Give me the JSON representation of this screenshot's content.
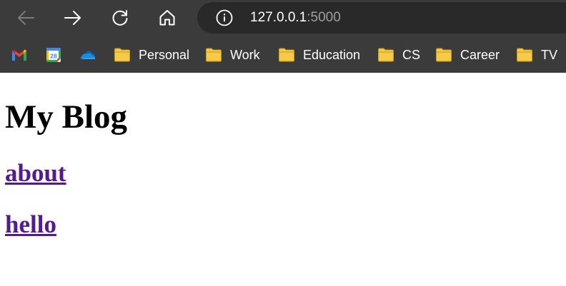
{
  "browser": {
    "nav": {
      "back_icon": "arrow-left-icon",
      "forward_icon": "arrow-right-icon",
      "reload_icon": "reload-icon",
      "home_icon": "home-icon"
    },
    "address_bar": {
      "security_icon": "info-icon",
      "host": "127.0.0.1",
      "port": ":5000"
    },
    "bookmarks": [
      {
        "icon": "gmail-icon"
      },
      {
        "icon": "calendar-icon",
        "badge": "28"
      },
      {
        "icon": "onedrive-icon"
      },
      {
        "icon": "folder-icon",
        "label": "Personal"
      },
      {
        "icon": "folder-icon",
        "label": "Work"
      },
      {
        "icon": "folder-icon",
        "label": "Education"
      },
      {
        "icon": "folder-icon",
        "label": "CS"
      },
      {
        "icon": "folder-icon",
        "label": "Career"
      },
      {
        "icon": "folder-icon",
        "label": "TV"
      }
    ],
    "colors": {
      "chrome_bg": "#3b3b3b",
      "omnibox_bg": "#292929",
      "folder_yellow": "#f7c948"
    }
  },
  "page": {
    "title": "My Blog",
    "links": [
      {
        "label": "about"
      },
      {
        "label": "hello"
      }
    ],
    "colors": {
      "link_visited": "#551a8b",
      "text": "#000000"
    }
  }
}
